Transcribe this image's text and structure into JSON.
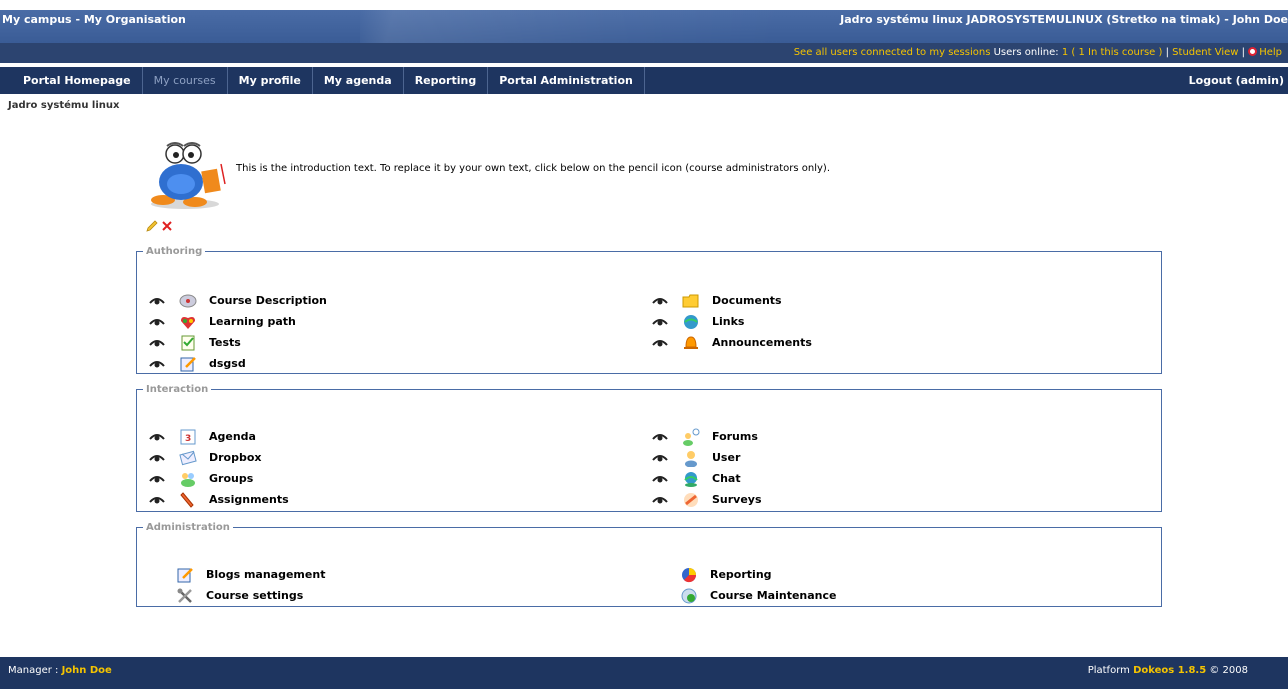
{
  "header": {
    "campus": "My campus",
    "separator": " - ",
    "organisation": "My Organisation",
    "course_info": "Jadro systému linux JADROSYSTEMULINUX (Stretko na timak) - John Doe"
  },
  "userbar": {
    "connected_link": "See all users connected to my sessions",
    "online_label": " Users online: ",
    "online_count": "1",
    "in_course": " ( 1 In this course )",
    "pipe1": "| ",
    "student_view": "Student View",
    "pipe2": " | ",
    "help": "Help"
  },
  "nav": {
    "tabs": [
      "Portal Homepage",
      "My courses",
      "My profile",
      "My agenda",
      "Reporting",
      "Portal Administration"
    ],
    "logout": "Logout (admin)"
  },
  "breadcrumb": "Jadro systému linux",
  "intro": {
    "text": "This is the introduction text. To replace it by your own text, click below on the pencil icon (course administrators only)."
  },
  "sections": {
    "authoring": {
      "legend": "Authoring",
      "left": [
        "Course Description",
        "Learning path",
        "Tests",
        "dsgsd"
      ],
      "right": [
        "Documents",
        "Links",
        "Announcements"
      ]
    },
    "interaction": {
      "legend": "Interaction",
      "left": [
        "Agenda",
        "Dropbox",
        "Groups",
        "Assignments"
      ],
      "right": [
        "Forums",
        "User",
        "Chat",
        "Surveys"
      ]
    },
    "administration": {
      "legend": "Administration",
      "left": [
        "Blogs management",
        "Course settings"
      ],
      "right": [
        "Reporting",
        "Course Maintenance"
      ]
    }
  },
  "footer": {
    "manager_label": "Manager : ",
    "manager_name": "John Doe",
    "platform_label": "Platform ",
    "platform_name": "Dokeos 1.8.5",
    "copyright": " © 2008"
  },
  "colors": {
    "accent": "#f5c400",
    "nav": "#1e3560",
    "header": "#4a6ca6"
  }
}
